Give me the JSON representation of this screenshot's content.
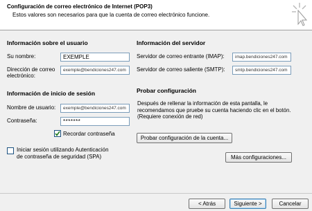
{
  "header": {
    "title": "Configuración de correo electrónico de Internet (POP3)",
    "subtitle": "Estos valores son necesarios para que la cuenta de correo electrónico funcione."
  },
  "user_info": {
    "heading": "Información sobre el usuario",
    "name_label": "Su nombre:",
    "name_value": "EXEMPLE",
    "email_label_line1": "Dirección de correo",
    "email_label_line2": "electrónico:",
    "email_value": "exemple@bendiciones247.com"
  },
  "login_info": {
    "heading": "Información de inicio de sesión",
    "username_label": "Nombre de usuario:",
    "username_value": "exemple@bendiciones247.com",
    "password_label": "Contraseña:",
    "password_value": "*******",
    "remember_label": "Recordar contraseña",
    "remember_checked": true
  },
  "spa": {
    "label_line1": "Iniciar sesión utilizando Autenticación",
    "label_line2": "de contraseña de seguridad (SPA)",
    "checked": false
  },
  "server_info": {
    "heading": "Información del servidor",
    "incoming_label": "Servidor de correo entrante (IMAP):",
    "incoming_value": "imap.bendiciones247.com",
    "outgoing_label": "Servidor de correo saliente (SMTP):",
    "outgoing_value": "smtp.bendiciones247.com"
  },
  "test": {
    "heading": "Probar configuración",
    "description": "Después de rellenar la información de esta pantalla, le recomendamos que pruebe su cuenta haciendo clic en el botón. (Requiere conexión de red)",
    "test_button": "Probar configuración de la cuenta...",
    "more_button": "Más configuraciones..."
  },
  "footer": {
    "back_button": "< Atrás",
    "next_button": "Siguiente >",
    "cancel_button": "Cancelar"
  },
  "icons": {
    "cursor": "click-cursor-icon",
    "checkmark": "checkmark-icon"
  }
}
